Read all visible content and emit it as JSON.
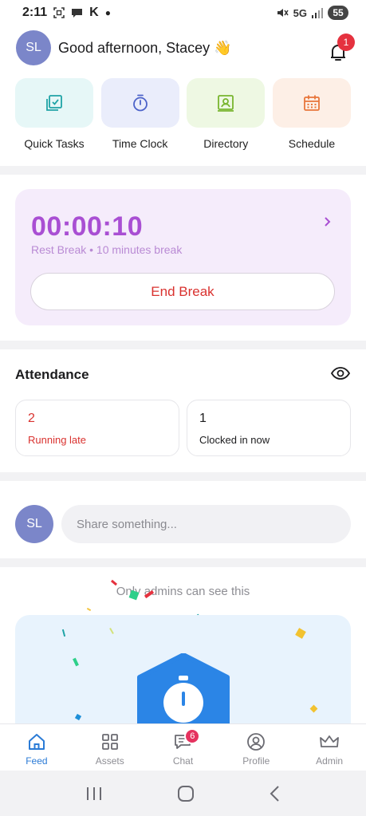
{
  "status_bar": {
    "time": "2:11",
    "carrier_letter": "K",
    "network": "5G",
    "battery": "55"
  },
  "header": {
    "avatar_initials": "SL",
    "greeting": "Good afternoon, Stacey 👋",
    "notification_count": "1"
  },
  "quick_actions": [
    {
      "label": "Quick Tasks",
      "icon": "checklist-icon",
      "bg": "#e6f7f7",
      "color": "#1fa3a6"
    },
    {
      "label": "Time Clock",
      "icon": "stopwatch-icon",
      "bg": "#eaedfb",
      "color": "#4d63c9"
    },
    {
      "label": "Directory",
      "icon": "contact-card-icon",
      "bg": "#eef8e3",
      "color": "#78b52f"
    },
    {
      "label": "Schedule",
      "icon": "calendar-icon",
      "bg": "#fdefe6",
      "color": "#e8763b"
    }
  ],
  "break_card": {
    "timer": "00:00:10",
    "subtitle": "Rest Break • 10 minutes break",
    "end_button": "End Break",
    "accent": "#a94fd3"
  },
  "attendance": {
    "title": "Attendance",
    "cards": [
      {
        "count": "2",
        "label": "Running late",
        "color": "#d9322f"
      },
      {
        "count": "1",
        "label": "Clocked in now",
        "color": "#1c1c1e"
      }
    ]
  },
  "share": {
    "avatar_initials": "SL",
    "placeholder": "Share something..."
  },
  "admin_post": {
    "note": "Only admins can see this"
  },
  "bottom_nav": [
    {
      "label": "Feed",
      "icon": "home-icon",
      "active": true
    },
    {
      "label": "Assets",
      "icon": "grid-icon",
      "active": false
    },
    {
      "label": "Chat",
      "icon": "chat-icon",
      "active": false,
      "badge": "6"
    },
    {
      "label": "Profile",
      "icon": "profile-icon",
      "active": false
    },
    {
      "label": "Admin",
      "icon": "crown-icon",
      "active": false
    }
  ]
}
